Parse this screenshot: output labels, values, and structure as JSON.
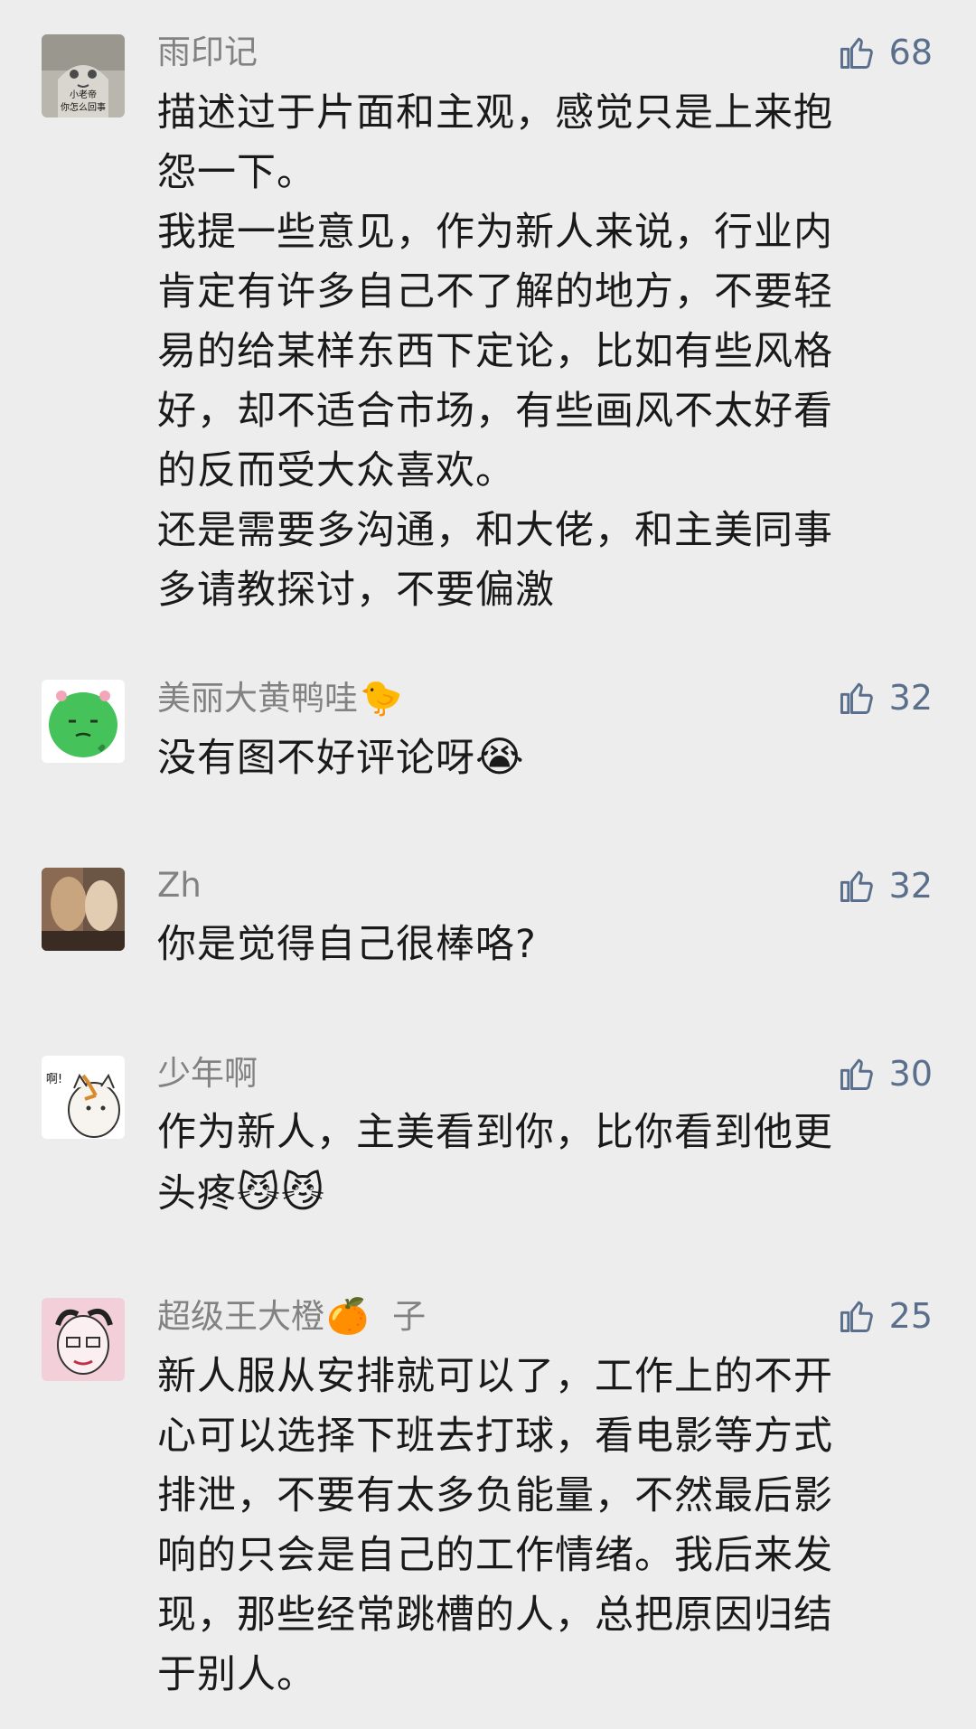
{
  "comments": [
    {
      "user": "雨印记",
      "avatar_caption_1": "小老帝",
      "avatar_caption_2": "你怎么回事",
      "likes": "68",
      "lines": [
        "描述过于片面和主观，感觉只是上来抱",
        "怨一下。",
        "我提一些意见，作为新人来说，行业内",
        "肯定有许多自己不了解的地方，不要轻",
        "易的给某样东西下定论，比如有些风格",
        "好，却不适合市场，有些画风不太好看",
        "的反而受大众喜欢。",
        "还是需要多沟通，和大佬，和主美同事",
        "多请教探讨，不要偏激"
      ]
    },
    {
      "user": "美丽大黄鸭哇",
      "user_emoji": "🐤",
      "likes": "32",
      "lines": [
        "没有图不好评论呀"
      ],
      "trailing_emoji": "😭"
    },
    {
      "user": "Zh",
      "likes": "32",
      "lines": [
        "你是觉得自己很棒咯?"
      ]
    },
    {
      "user": "少年啊",
      "avatar_caption": "啊!",
      "likes": "30",
      "lines": [
        "作为新人，主美看到你，比你看到他更",
        "头疼"
      ],
      "trailing_emoji": "😼😼"
    },
    {
      "user": "超级王大橙",
      "user_emoji": "🍊",
      "user_suffix": "子",
      "likes": "25",
      "lines": [
        "新人服从安排就可以了，工作上的不开",
        "心可以选择下班去打球，看电影等方式",
        "排泄，不要有太多负能量，不然最后影",
        "响的只会是自己的工作情绪。我后来发",
        "现，那些经常跳槽的人，总把原因归结",
        "于别人。"
      ]
    }
  ],
  "colors": {
    "background": "#ededed",
    "name": "#828282",
    "like_accent": "#5a6f8c",
    "text": "#1a1a1a"
  },
  "icons": {
    "like": "thumbs-up-icon"
  }
}
